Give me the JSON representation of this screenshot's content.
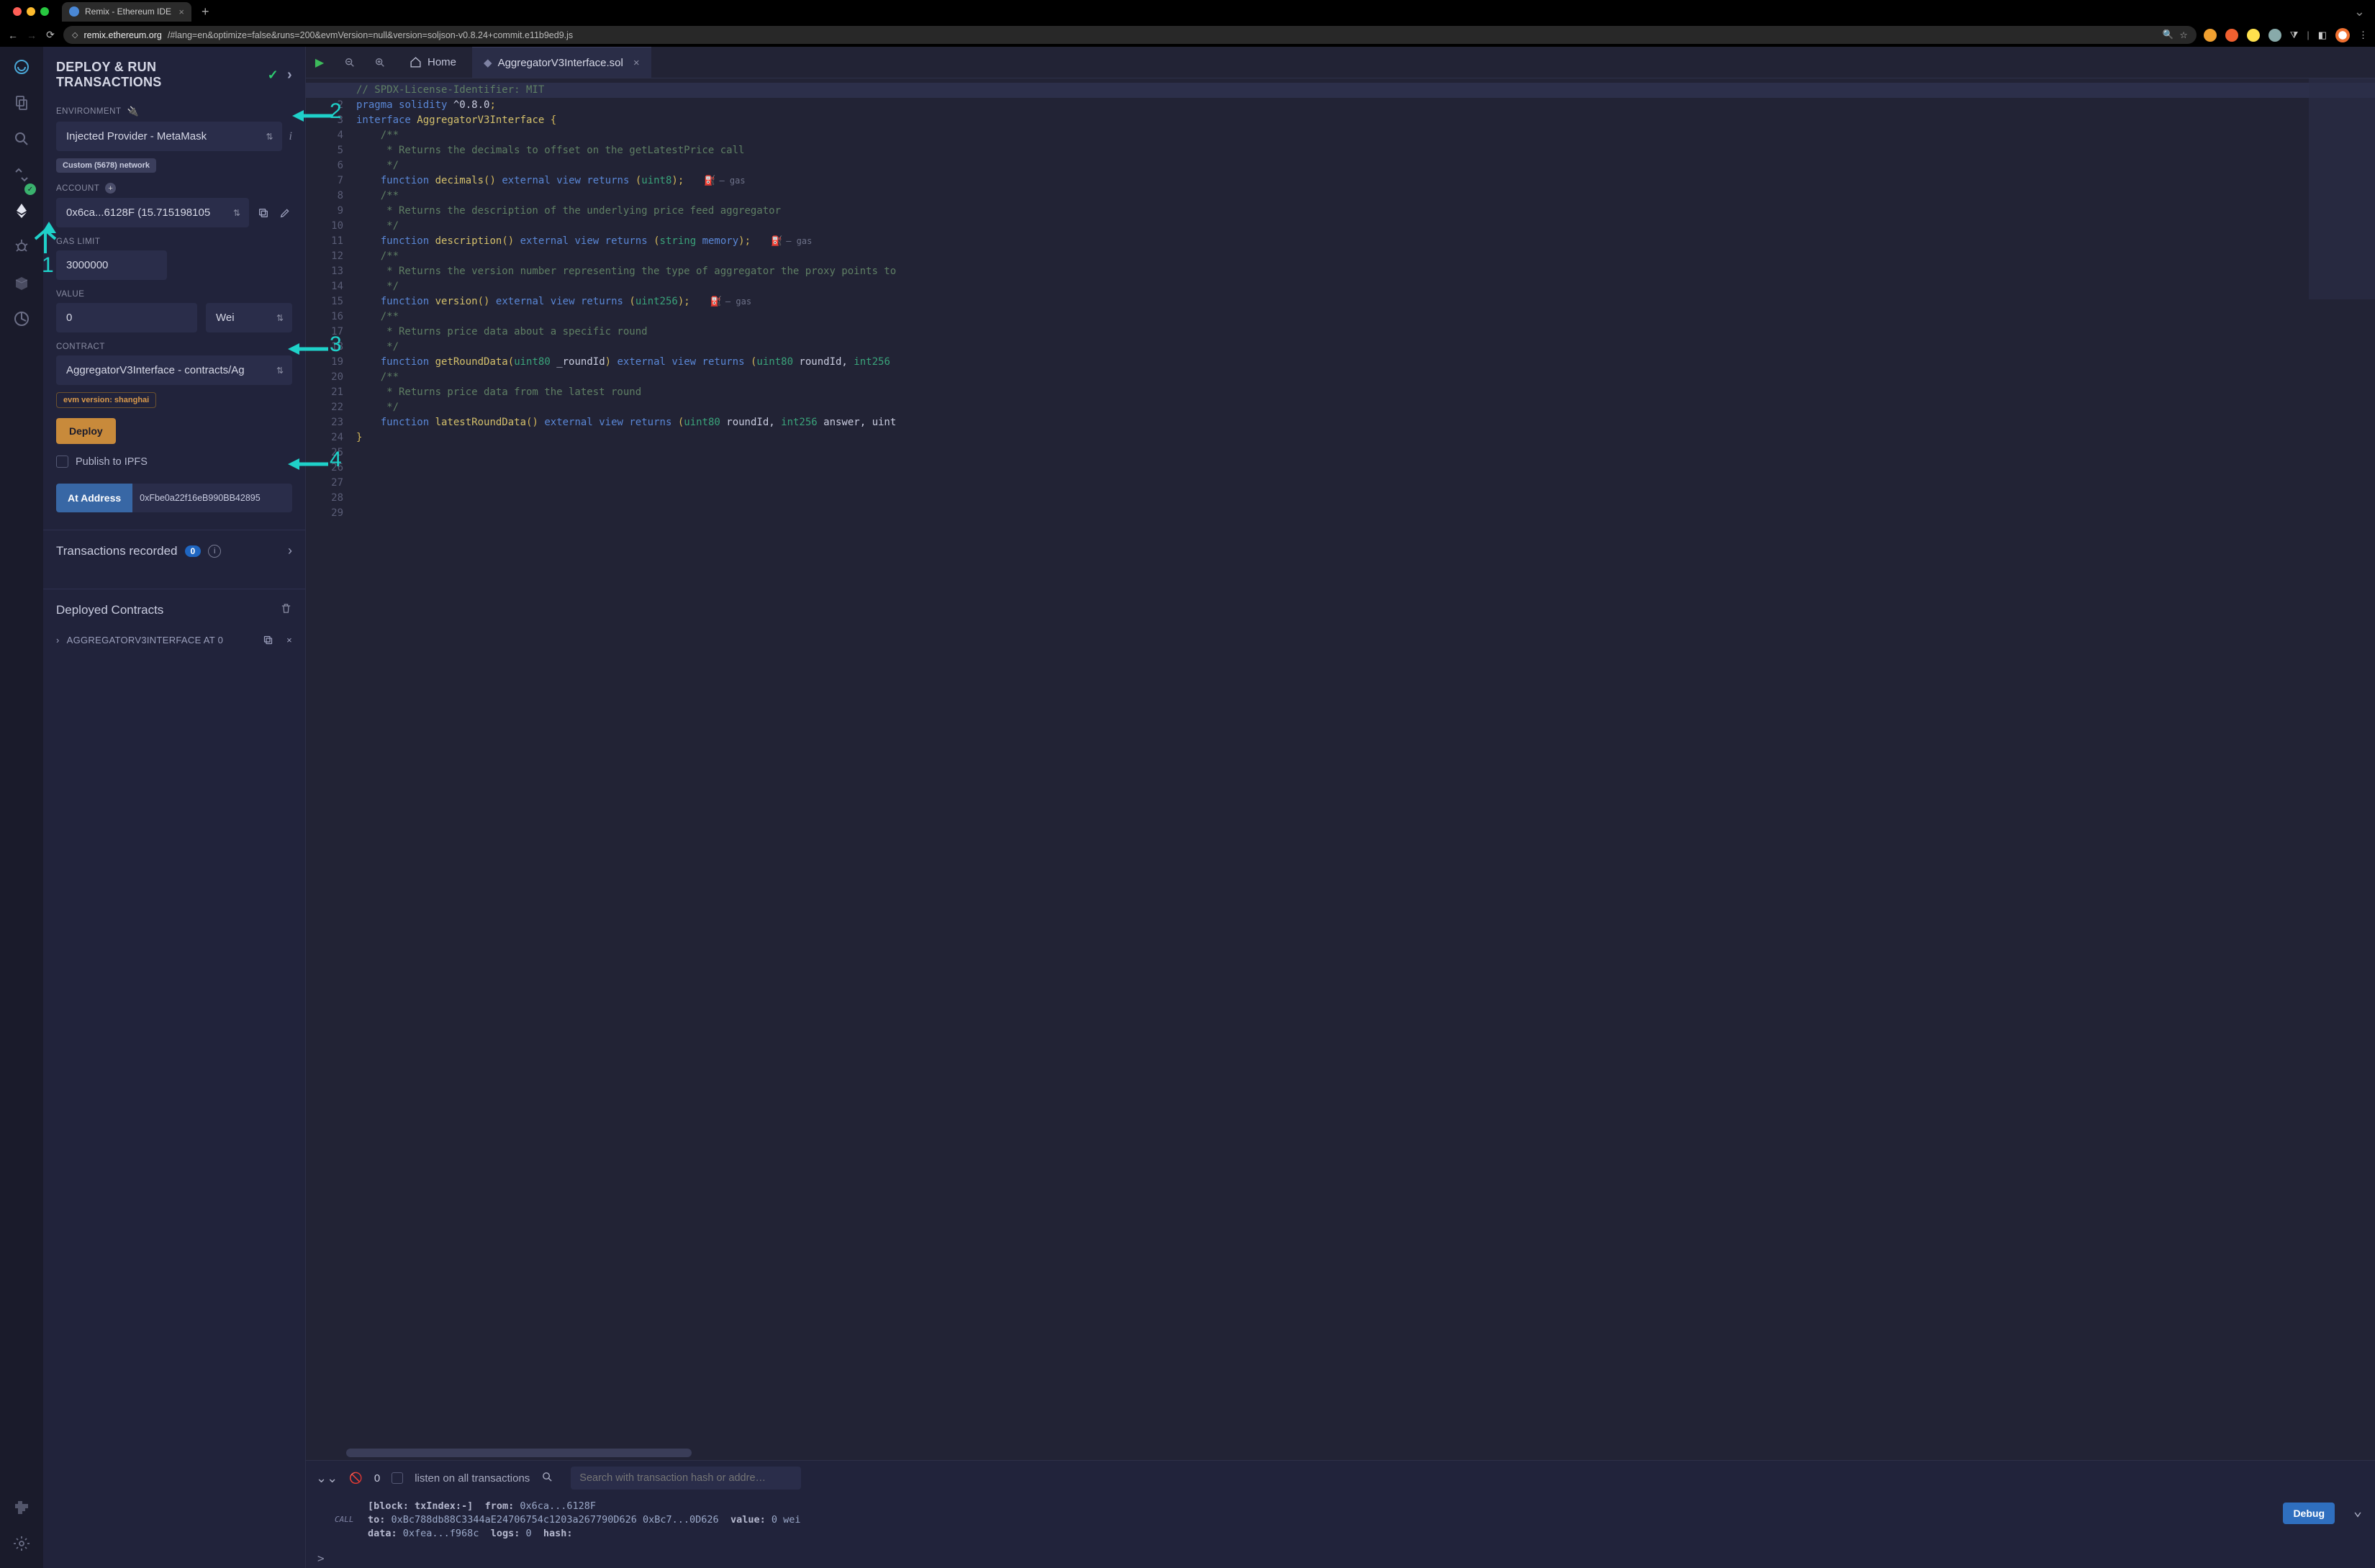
{
  "browser": {
    "tab_title": "Remix - Ethereum IDE",
    "url_host": "remix.ethereum.org",
    "url_path": "/#lang=en&optimize=false&runs=200&evmVersion=null&version=soljson-v0.8.24+commit.e11b9ed9.js"
  },
  "panel": {
    "title": "DEPLOY & RUN TRANSACTIONS",
    "env_label": "ENVIRONMENT",
    "env_value": "Injected Provider - MetaMask",
    "network_badge": "Custom (5678) network",
    "account_label": "ACCOUNT",
    "account_value": "0x6ca...6128F (15.715198105",
    "gas_label": "GAS LIMIT",
    "gas_value": "3000000",
    "value_label": "VALUE",
    "value_value": "0",
    "value_unit": "Wei",
    "contract_label": "CONTRACT",
    "contract_value": "AggregatorV3Interface - contracts/Ag",
    "evm_badge": "evm version: shanghai",
    "deploy_btn": "Deploy",
    "publish_ipfs": "Publish to IPFS",
    "at_address_btn": "At Address",
    "at_address_value": "0xFbe0a22f16eB990BB42895",
    "tx_recorded": "Transactions recorded",
    "tx_count": "0",
    "deployed_title": "Deployed Contracts",
    "deployed_item": "AGGREGATORV3INTERFACE AT 0"
  },
  "editor": {
    "home": "Home",
    "filename": "AggregatorV3Interface.sol",
    "gas_label": "– gas",
    "lines": [
      "// SPDX-License-Identifier: MIT",
      "pragma solidity ^0.8.0;",
      "",
      "interface AggregatorV3Interface {",
      "    /**",
      "     * Returns the decimals to offset on the getLatestPrice call",
      "     */",
      "    function decimals() external view returns (uint8);",
      "",
      "    /**",
      "     * Returns the description of the underlying price feed aggregator",
      "     */",
      "    function description() external view returns (string memory);",
      "",
      "    /**",
      "     * Returns the version number representing the type of aggregator the proxy points to",
      "     */",
      "    function version() external view returns (uint256);",
      "",
      "    /**",
      "     * Returns price data about a specific round",
      "     */",
      "    function getRoundData(uint80 _roundId) external view returns (uint80 roundId, int256",
      "",
      "    /**",
      "     * Returns price data from the latest round",
      "     */",
      "    function latestRoundData() external view returns (uint80 roundId, int256 answer, uint",
      "}"
    ]
  },
  "terminal": {
    "listen_label": "listen on all transactions",
    "count": "0",
    "search_placeholder": "Search with transaction hash or addre…",
    "call_tag": "CALL",
    "line1_pre": "[block: txIndex:-]",
    "from_k": "from:",
    "from_v": "0x6ca...6128F",
    "to_k": "to:",
    "to_v": "0xBc788db88C3344aE24706754c1203a267790D626 0xBc7...0D626",
    "value_k": "value:",
    "value_v": "0 wei",
    "data_k": "data:",
    "data_v": "0xfea...f968c",
    "logs_k": "logs:",
    "logs_v": "0",
    "hash_k": "hash:",
    "debug_btn": "Debug",
    "prompt": ">"
  },
  "annotations": {
    "n1": "1",
    "n2": "2",
    "n3": "3",
    "n4": "4"
  }
}
